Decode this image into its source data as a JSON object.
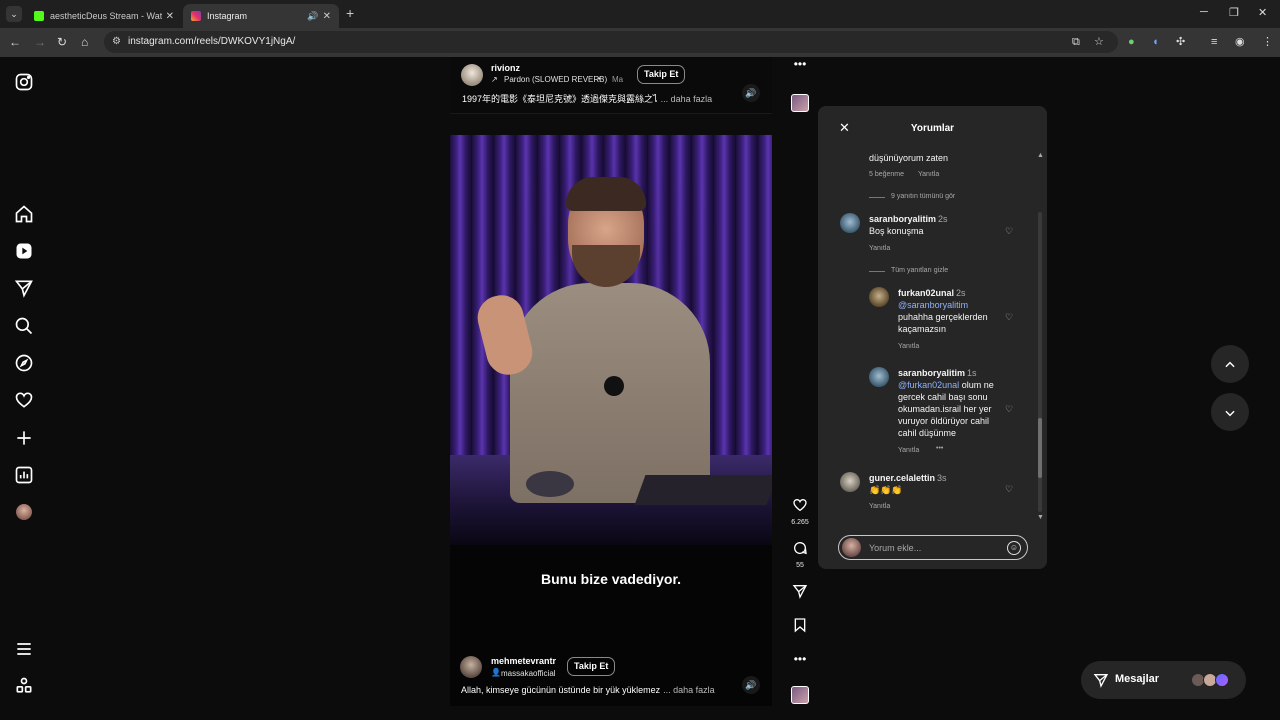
{
  "browser": {
    "tabs": [
      {
        "title": "aestheticDeus Stream - Watch l",
        "favicon_color": "#53fc18",
        "active": false
      },
      {
        "title": "Instagram",
        "favicon_color": "#e1306c",
        "active": true
      }
    ],
    "url": "instagram.com/reels/DWKOVY1jNgA/"
  },
  "sidebar": {
    "items": [
      {
        "name": "instagram-logo-icon"
      },
      {
        "name": "home-icon"
      },
      {
        "name": "reels-icon"
      },
      {
        "name": "direct-send-icon"
      },
      {
        "name": "search-icon"
      },
      {
        "name": "explore-icon"
      },
      {
        "name": "notifications-heart-icon"
      },
      {
        "name": "create-plus-icon"
      },
      {
        "name": "dashboard-icon"
      },
      {
        "name": "profile-avatar"
      },
      {
        "name": "menu-icon"
      },
      {
        "name": "also-from-meta-icon"
      }
    ]
  },
  "top_reel": {
    "username": "rivionz",
    "audio": "Pardon (SLOWED REVERB)",
    "audio_more": "Ma",
    "follow_label": "Takip Et",
    "caption": "1997年的電影《泰坦尼克號》透過傑克與露絲之ไ",
    "more_label": "... daha fazla"
  },
  "reel": {
    "subtitle": "Bunu bize vadediyor.",
    "username": "mehmetevrantr",
    "sub_account": "massakaofficial",
    "follow_label": "Takip Et",
    "caption": "Allah, kimseye gücünün üstünde bir yük yüklemez",
    "more_label": "... daha fazla",
    "likes": "6.265",
    "comments": "55"
  },
  "comments_panel": {
    "title": "Yorumlar",
    "partial_text": "düşünüyorum zaten",
    "partial_likes": "5 beğenme",
    "reply_label": "Yanıtla",
    "view_replies": "9 yanıtın tümünü gör",
    "hide_replies": "Tüm yanıtları gizle",
    "comments": [
      {
        "user": "saranboryalitim",
        "time": "2s",
        "text": "Boş konuşma",
        "reply": "Yanıtla"
      },
      {
        "user": "furkan02unal",
        "time": "2s",
        "mention": "@saranboryalitim",
        "text": "puhahha gerçeklerden kaçamazsın",
        "reply": "Yanıtla"
      },
      {
        "user": "saranboryalitim",
        "time": "1s",
        "mention": "@furkan02unal",
        "text": "olum ne gercek cahil başı sonu okumadan.israil her yer vuruyor öldürüyor cahil cahil düşünme",
        "reply": "Yanıtla",
        "extra": "•••"
      },
      {
        "user": "guner.celalettin",
        "time": "3s",
        "text": "👏👏👏",
        "reply": "Yanıtla"
      }
    ],
    "input_placeholder": "Yorum ekle..."
  },
  "messages": {
    "label": "Mesajlar"
  }
}
